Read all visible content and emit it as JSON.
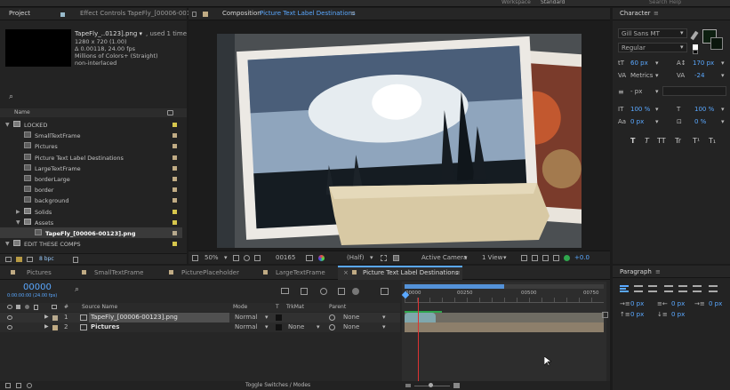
{
  "top_bar": {
    "workspace": "Workspace",
    "workspace_value": "Standard",
    "search": "Search Help"
  },
  "project_panel": {
    "tabs": [
      "Project",
      "Effect Controls TapeFly_[00006-0012"
    ],
    "thumb_name": "TapeFly_..0123].png ▾",
    "thumb_used": ", used 1 time",
    "thumb_info": [
      "1280 x 720 (1.00)",
      "Δ 0.00118, 24.00 fps",
      "Millions of Colors+ (Straight)",
      "non-interlaced"
    ],
    "search_placeholder": "⌕",
    "col_name": "Name",
    "items": [
      {
        "label": "LOCKED",
        "twirl": "▼",
        "type": "folder",
        "swatch": "#d6c64c"
      },
      {
        "label": "SmallTextFrame",
        "twirl": "",
        "type": "comp",
        "swatch": "#c0ab84"
      },
      {
        "label": "Pictures",
        "twirl": "",
        "type": "comp",
        "swatch": "#c0ab84"
      },
      {
        "label": "Picture Text Label Destinations",
        "twirl": "",
        "type": "comp",
        "swatch": "#c0ab84"
      },
      {
        "label": "LargeTextFrame",
        "twirl": "",
        "type": "comp",
        "swatch": "#c0ab84"
      },
      {
        "label": "borderLarge",
        "twirl": "",
        "type": "comp",
        "swatch": "#c0ab84"
      },
      {
        "label": "border",
        "twirl": "",
        "type": "comp",
        "swatch": "#c0ab84"
      },
      {
        "label": "background",
        "twirl": "",
        "type": "comp",
        "swatch": "#c0ab84"
      },
      {
        "label": "Solids",
        "twirl": "▶",
        "type": "folder",
        "swatch": "#d6c64c"
      },
      {
        "label": "Assets",
        "twirl": "▼",
        "type": "folder",
        "swatch": "#d6c64c"
      },
      {
        "label": "TapeFly_[00006-00123].png",
        "twirl": "",
        "type": "file",
        "swatch": "#b7a98e"
      },
      {
        "label": "EDIT THESE COMPS",
        "twirl": "▼",
        "type": "folder",
        "swatch": "#d6c64c"
      }
    ],
    "bpc": "8 bpc"
  },
  "composition": {
    "tab_prefix": "Composition",
    "tab_name": "Picture Text Label Destinations",
    "zoom": "50%",
    "timecode": "00165",
    "resolution": "(Half)",
    "camera": "Active Camera",
    "views": "1 View",
    "exposure": "+0.0"
  },
  "character": {
    "title": "Character",
    "font": "Gill Sans MT",
    "style": "Regular",
    "size": "60 px",
    "leading": "170 px",
    "kerning": "Metrics",
    "tracking": "-24",
    "stroke": "- px",
    "vscale": "100 %",
    "hscale": "100 %",
    "baseline": "0 px",
    "tsume": "0 %",
    "styles": [
      "T",
      "T",
      "TT",
      "Tr",
      "T¹",
      "T₁"
    ]
  },
  "paragraph": {
    "title": "Paragraph",
    "indents": [
      "0 px",
      "0 px",
      "0 px",
      "0 px",
      "0 px"
    ]
  },
  "timeline": {
    "tabs": [
      "Pictures",
      "SmallTextFrame",
      "PicturePlaceholder",
      "LargeTextFrame",
      "Picture Text Label Destinations"
    ],
    "timecode": "00000",
    "timecode_sub": "0:00:00:00 (24.00 fps)",
    "col_source": "Source Name",
    "col_mode": "Mode",
    "col_t": "T",
    "col_trkmat": "TrkMat",
    "col_parent": "Parent",
    "col_num": "#",
    "ruler": [
      "00000",
      "00250",
      "00500",
      "00750"
    ],
    "layers": [
      {
        "num": "1",
        "name": "TapeFly_[00006-00123].png",
        "mode": "Normal",
        "trkmat": "",
        "parent": "None"
      },
      {
        "num": "2",
        "name": "Pictures",
        "mode": "Normal",
        "trkmat": "None",
        "parent": "None"
      }
    ],
    "toggle": "Toggle Switches / Modes"
  }
}
